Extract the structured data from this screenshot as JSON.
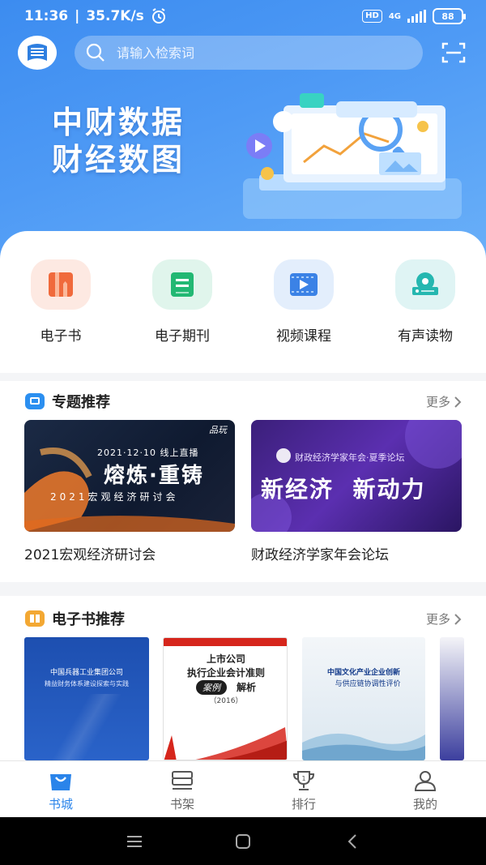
{
  "status_bar": {
    "time": "11:36",
    "net_speed": "35.7K/s",
    "hd": "HD",
    "network": "4G",
    "battery": "88"
  },
  "header": {
    "search_placeholder": "请输入检索词",
    "logo_icon": "book-logo-icon",
    "scan_icon": "scan-icon"
  },
  "banner": {
    "line1": "中财数据",
    "line2": "财经数图"
  },
  "categories": [
    {
      "label": "电子书",
      "icon": "ebook-icon",
      "bg": "#fde9e2",
      "color": "#f06a3c"
    },
    {
      "label": "电子期刊",
      "icon": "journal-icon",
      "bg": "#e0f5ec",
      "color": "#22b873"
    },
    {
      "label": "视频课程",
      "icon": "video-icon",
      "bg": "#e3eefc",
      "color": "#3b82e6"
    },
    {
      "label": "有声读物",
      "icon": "audio-icon",
      "bg": "#dff4f4",
      "color": "#25b7b0"
    }
  ],
  "topics": {
    "title": "专题推荐",
    "more": "更多",
    "items": [
      {
        "caption": "2021宏观经济研讨会",
        "card_line1": "2021·12·10  线上直播",
        "card_main": "熔炼·重铸",
        "card_line2": "2021宏观经济研讨会",
        "card_brand": "品玩"
      },
      {
        "caption": "财政经济学家年会论坛",
        "card_line1": "财政经济学家年会·夏季论坛",
        "card_main": "新经济  新动力"
      }
    ]
  },
  "ebooks": {
    "title": "电子书推荐",
    "more": "更多",
    "books": [
      {
        "title": "中国兵器工业集团公司",
        "subtitle": "精益财务体系建设探索与实践"
      },
      {
        "title": "上市公司\n执行企业会计准则",
        "badge": "案例",
        "suffix": "解析",
        "year": "（2016）"
      },
      {
        "title": "中国文化产业企业创新",
        "subtitle": "与供应链协调性评价"
      }
    ]
  },
  "tabs": [
    {
      "label": "书城",
      "icon": "bookstore-icon",
      "active": true
    },
    {
      "label": "书架",
      "icon": "bookshelf-icon",
      "active": false
    },
    {
      "label": "排行",
      "icon": "trophy-icon",
      "active": false
    },
    {
      "label": "我的",
      "icon": "user-icon",
      "active": false
    }
  ]
}
